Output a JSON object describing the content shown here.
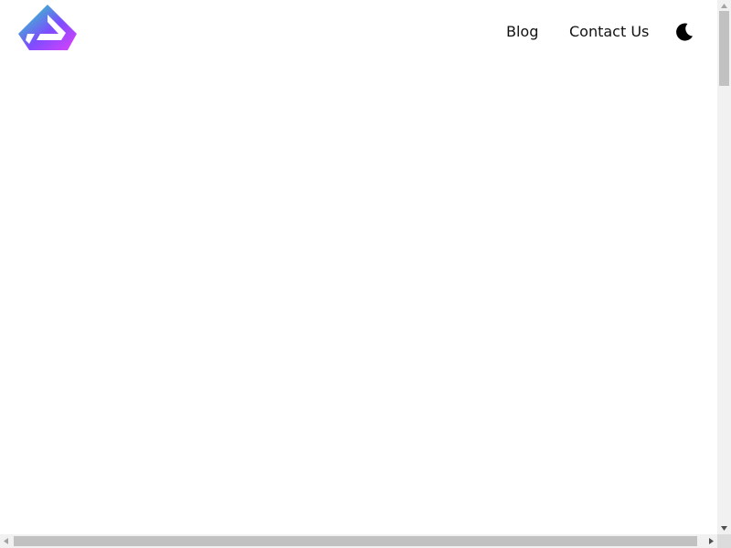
{
  "navbar": {
    "logo_icon": "gradient-hexagon-logo-icon",
    "links": {
      "blog": "Blog",
      "contact": "Contact Us"
    },
    "theme_toggle_icon": "moon-icon"
  },
  "colors": {
    "logo_gradient_start": "#1de9b6",
    "logo_gradient_mid": "#7c4dff",
    "logo_gradient_end": "#e040fb",
    "text": "#111111",
    "background": "#ffffff",
    "scrollbar_track": "#f1f1f1",
    "scrollbar_thumb": "#c1c1c1"
  }
}
